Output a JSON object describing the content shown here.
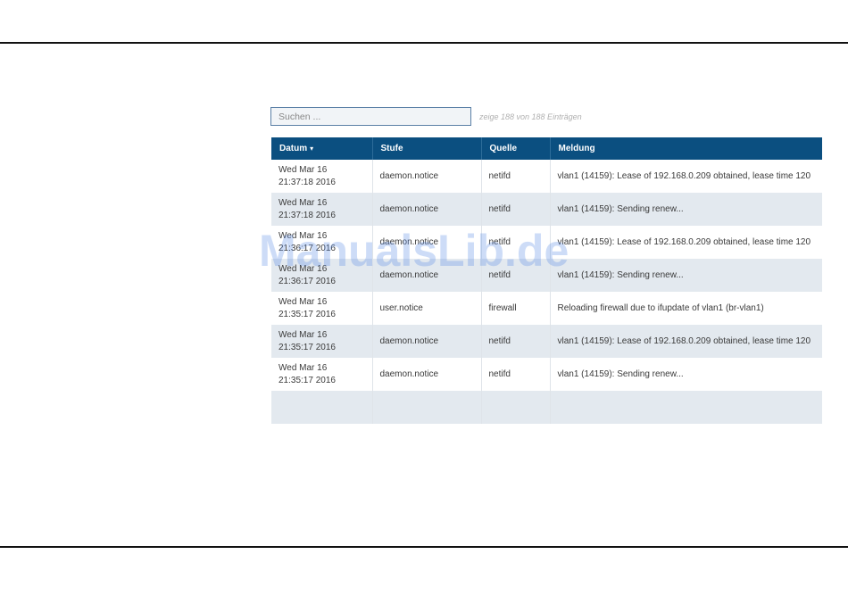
{
  "search": {
    "placeholder": "Suchen ..."
  },
  "entries_info": "zeige 188 von 188 Einträgen",
  "table": {
    "columns": [
      {
        "label": "Datum",
        "sort": "▾"
      },
      {
        "label": "Stufe"
      },
      {
        "label": "Quelle"
      },
      {
        "label": "Meldung"
      }
    ],
    "rows": [
      {
        "date": "Wed Mar 16",
        "time": "21:37:18 2016",
        "level": "daemon.notice",
        "source": "netifd",
        "message": "vlan1 (14159): Lease of 192.168.0.209 obtained, lease time 120"
      },
      {
        "date": "Wed Mar 16",
        "time": "21:37:18 2016",
        "level": "daemon.notice",
        "source": "netifd",
        "message": "vlan1 (14159): Sending renew..."
      },
      {
        "date": "Wed Mar 16",
        "time": "21:36:17 2016",
        "level": "daemon.notice",
        "source": "netifd",
        "message": "vlan1 (14159): Lease of 192.168.0.209 obtained, lease time 120"
      },
      {
        "date": "Wed Mar 16",
        "time": "21:36:17 2016",
        "level": "daemon.notice",
        "source": "netifd",
        "message": "vlan1 (14159): Sending renew..."
      },
      {
        "date": "Wed Mar 16",
        "time": "21:35:17 2016",
        "level": "user.notice",
        "source": "firewall",
        "message": "Reloading firewall due to ifupdate of vlan1 (br-vlan1)"
      },
      {
        "date": "Wed Mar 16",
        "time": "21:35:17 2016",
        "level": "daemon.notice",
        "source": "netifd",
        "message": "vlan1 (14159): Lease of 192.168.0.209 obtained, lease time 120"
      },
      {
        "date": "Wed Mar 16",
        "time": "21:35:17 2016",
        "level": "daemon.notice",
        "source": "netifd",
        "message": "vlan1 (14159): Sending renew..."
      }
    ]
  },
  "watermark": "ManualsLib.de",
  "colors": {
    "header_bg": "#0b4f80",
    "row_alt": "#e3e9ef",
    "search_border": "#5a7fa6"
  }
}
